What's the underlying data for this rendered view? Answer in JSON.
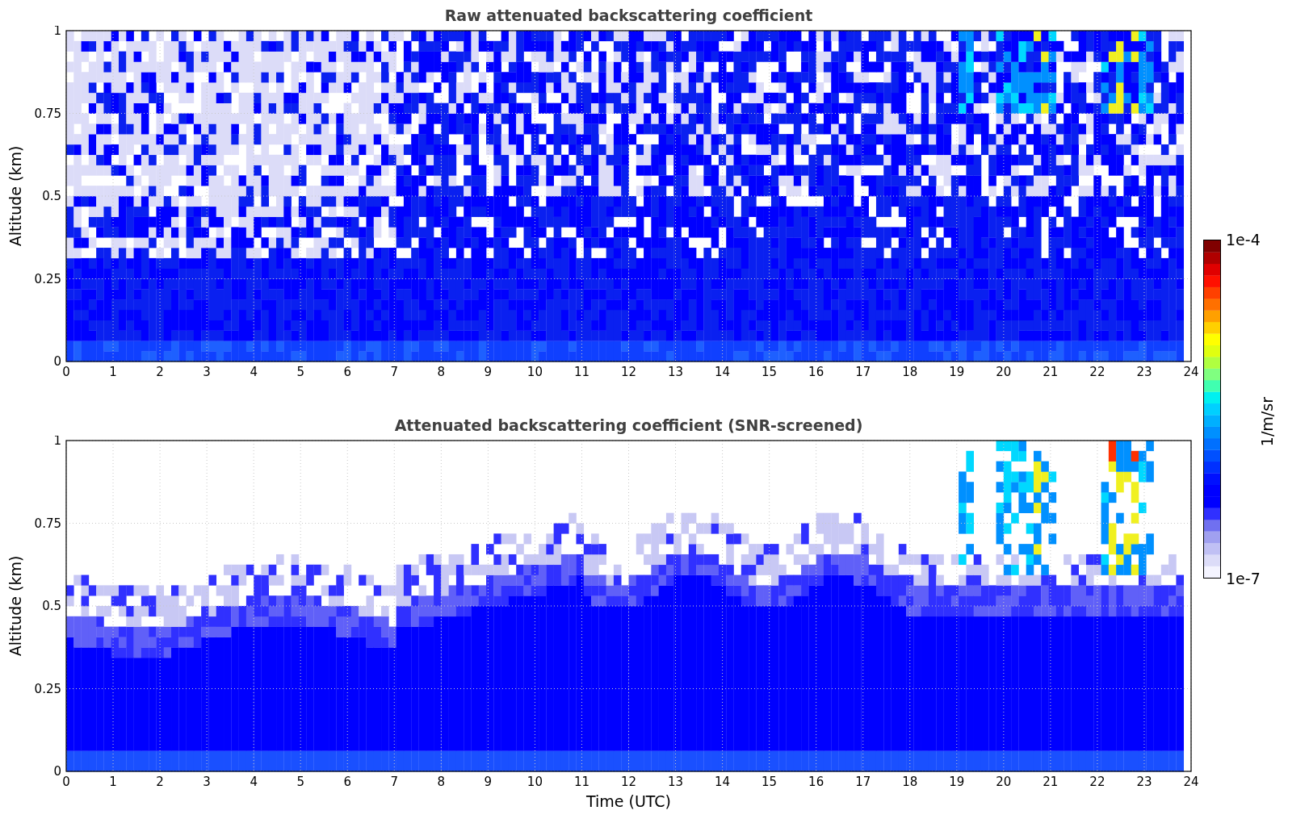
{
  "panels": [
    {
      "kind": "raw",
      "title": "Raw attenuated backscattering coefficient",
      "ylabel": "Altitude (km)",
      "yticks": [
        "1",
        "0.75",
        "0.5",
        "0.25",
        "0"
      ],
      "xticks": [
        "0",
        "1",
        "2",
        "3",
        "4",
        "5",
        "6",
        "7",
        "8",
        "9",
        "10",
        "11",
        "12",
        "13",
        "14",
        "15",
        "16",
        "17",
        "18",
        "19",
        "20",
        "21",
        "22",
        "23",
        "24"
      ]
    },
    {
      "kind": "screened",
      "title": "Attenuated backscattering coefficient (SNR-screened)",
      "ylabel": "Altitude (km)",
      "yticks": [
        "1",
        "0.75",
        "0.5",
        "0.25",
        "0"
      ],
      "xticks": [
        "0",
        "1",
        "2",
        "3",
        "4",
        "5",
        "6",
        "7",
        "8",
        "9",
        "10",
        "11",
        "12",
        "13",
        "14",
        "15",
        "16",
        "17",
        "18",
        "19",
        "20",
        "21",
        "22",
        "23",
        "24"
      ],
      "xlabel": "Time (UTC)"
    }
  ],
  "colorbar": {
    "max": "1e-4",
    "min": "1e-7",
    "label": "1/m/sr"
  }
}
